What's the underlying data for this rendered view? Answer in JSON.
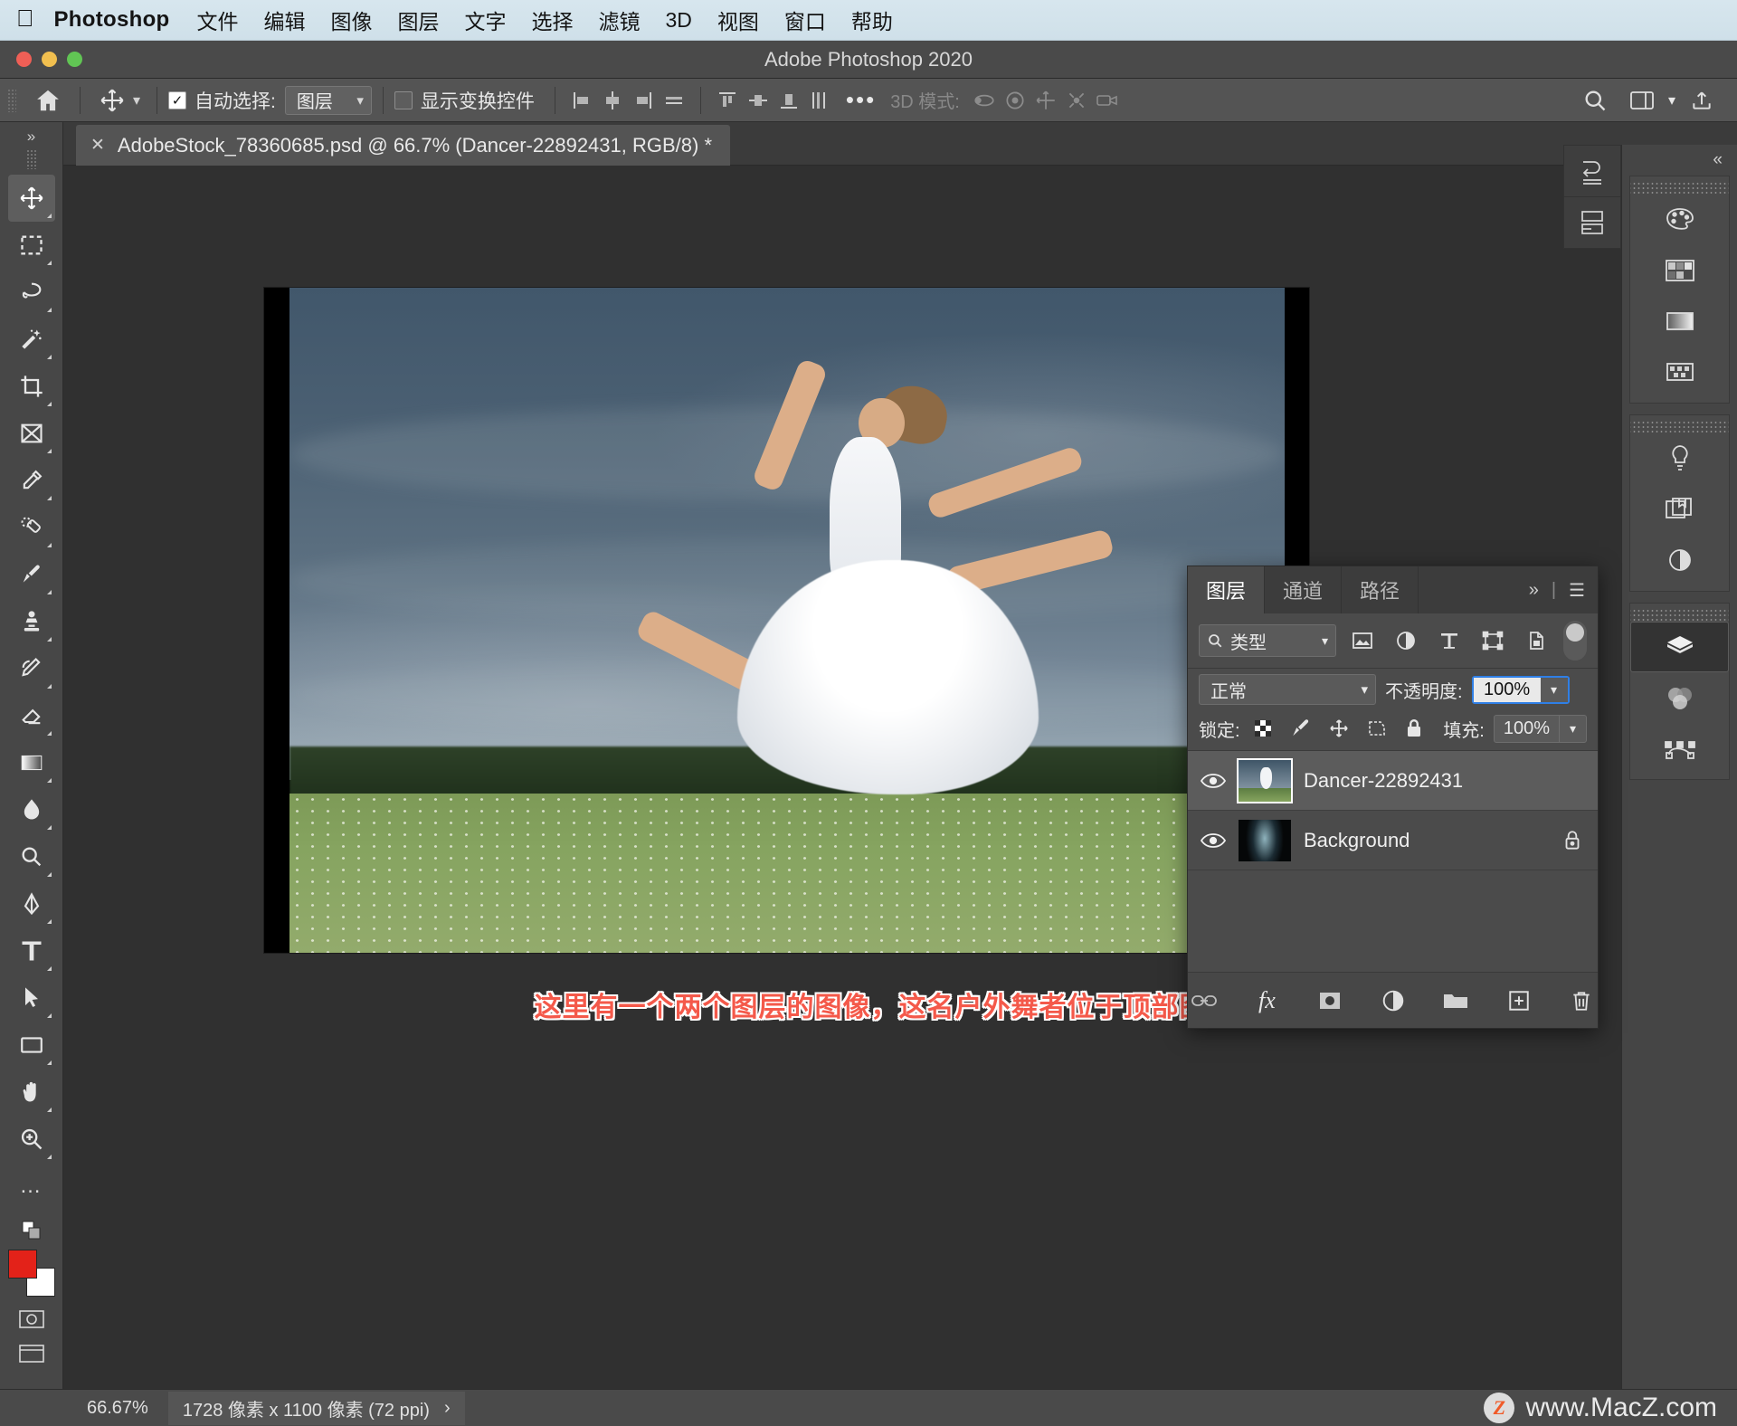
{
  "macbar": {
    "apple_icon": "apple-logo-icon",
    "app_name": "Photoshop",
    "menus": [
      "文件",
      "编辑",
      "图像",
      "图层",
      "文字",
      "选择",
      "滤镜",
      "3D",
      "视图",
      "窗口",
      "帮助"
    ]
  },
  "titlebar": {
    "title": "Adobe Photoshop 2020"
  },
  "options": {
    "home_icon": "home-icon",
    "tool_icon": "move-tool-icon",
    "auto_select_checked": true,
    "auto_select_label": "自动选择:",
    "auto_select_value": "图层",
    "show_transform_checked": false,
    "show_transform_label": "显示变换控件",
    "align_icons": [
      "align-left-edges-icon",
      "align-horizontal-centers-icon",
      "align-right-edges-icon",
      "distribute-horizontally-icon",
      "align-top-edges-icon",
      "align-vertical-centers-icon",
      "align-bottom-edges-icon",
      "distribute-vertically-icon"
    ],
    "more_label": "•••",
    "mode3d_label": "3D 模式:",
    "mode3d_icons": [
      "orbit-3d-icon",
      "roll-3d-icon",
      "pan-3d-icon",
      "slide-3d-icon",
      "camera-3d-icon"
    ],
    "right_icons": [
      "search-icon",
      "workspace-icon",
      "chevron-down-icon",
      "share-icon"
    ]
  },
  "document_tab": {
    "close_icon": "close-icon",
    "label": "AdobeStock_78360685.psd @ 66.7% (Dancer-22892431, RGB/8) *"
  },
  "toolbar": {
    "expand_icon": "expand-panel-icon",
    "tools": [
      {
        "name": "move-tool",
        "selected": true
      },
      {
        "name": "rectangular-marquee-tool",
        "selected": false
      },
      {
        "name": "lasso-tool",
        "selected": false
      },
      {
        "name": "magic-wand-tool",
        "selected": false
      },
      {
        "name": "crop-tool",
        "selected": false
      },
      {
        "name": "frame-tool",
        "selected": false
      },
      {
        "name": "eyedropper-tool",
        "selected": false
      },
      {
        "name": "healing-brush-tool",
        "selected": false
      },
      {
        "name": "brush-tool",
        "selected": false
      },
      {
        "name": "clone-stamp-tool",
        "selected": false
      },
      {
        "name": "history-brush-tool",
        "selected": false
      },
      {
        "name": "eraser-tool",
        "selected": false
      },
      {
        "name": "gradient-tool",
        "selected": false
      },
      {
        "name": "blur-tool",
        "selected": false
      },
      {
        "name": "dodge-tool",
        "selected": false
      },
      {
        "name": "pen-tool",
        "selected": false
      },
      {
        "name": "type-tool",
        "selected": false
      },
      {
        "name": "path-selection-tool",
        "selected": false
      },
      {
        "name": "rectangle-tool",
        "selected": false
      },
      {
        "name": "hand-tool",
        "selected": false
      },
      {
        "name": "zoom-tool",
        "selected": false
      },
      {
        "name": "edit-toolbar-tool",
        "selected": false
      }
    ],
    "foreground_color": "#e32219",
    "background_color": "#ffffff"
  },
  "canvas": {
    "caption": "这里有一个两个图层的图像，这名户外舞者位于顶部图"
  },
  "layers_panel": {
    "tabs": [
      {
        "label": "图层",
        "active": true
      },
      {
        "label": "通道",
        "active": false
      },
      {
        "label": "路径",
        "active": false
      }
    ],
    "expand_label": "»",
    "menu_icon": "panel-menu-icon",
    "filter": {
      "search_icon": "search-icon",
      "value": "类型",
      "chevron": "chevron-down-icon",
      "kind_icons": [
        "filter-pixel-icon",
        "filter-adjustment-icon",
        "filter-type-icon",
        "filter-shape-icon",
        "filter-smart-object-icon"
      ],
      "toggle_on": false
    },
    "blend_mode": "正常",
    "opacity_label": "不透明度:",
    "opacity_value": "100%",
    "lock_label": "锁定:",
    "lock_icons": [
      "lock-transparent-pixels-icon",
      "lock-image-pixels-icon",
      "lock-position-icon",
      "lock-artboard-nesting-icon",
      "lock-all-icon"
    ],
    "fill_label": "填充:",
    "fill_value": "100%",
    "layers": [
      {
        "name": "Dancer-22892431",
        "visible": true,
        "selected": true,
        "locked": false,
        "thumb": "dancer-thumb"
      },
      {
        "name": "Background",
        "visible": true,
        "selected": false,
        "locked": true,
        "thumb": "background-thumb"
      }
    ],
    "bottom_icons": [
      "link-layers-icon",
      "layer-style-fx-icon",
      "add-layer-mask-icon",
      "new-adjustment-layer-icon",
      "new-group-icon",
      "new-layer-icon",
      "delete-layer-icon"
    ]
  },
  "right_rail": {
    "collapse_icon": "collapse-panels-icon",
    "groups": [
      {
        "items": [
          "color-panel-icon",
          "swatches-panel-icon",
          "gradients-panel-icon",
          "patterns-panel-icon"
        ]
      },
      {
        "items": [
          "adjustments-panel-icon",
          "libraries-panel-icon",
          "adjustment-layer-icon"
        ]
      },
      {
        "items": [
          "layers-panel-icon",
          "channels-panel-icon",
          "paths-panel-icon"
        ]
      }
    ],
    "selected": "layers-panel-icon",
    "narrow_dock": [
      "history-panel-icon",
      "properties-panel-icon"
    ]
  },
  "statusbar": {
    "zoom": "66.67%",
    "dimensions": "1728 像素 x 1100 像素 (72 ppi)",
    "chevron": "›",
    "watermark_badge": "Z",
    "watermark_text": "www.MacZ.com"
  },
  "colors": {
    "accent_blue": "#2f7fe6",
    "caption_red": "#f4594a",
    "chrome": "#4b4b4b",
    "menubar": "#d7e6ee"
  }
}
